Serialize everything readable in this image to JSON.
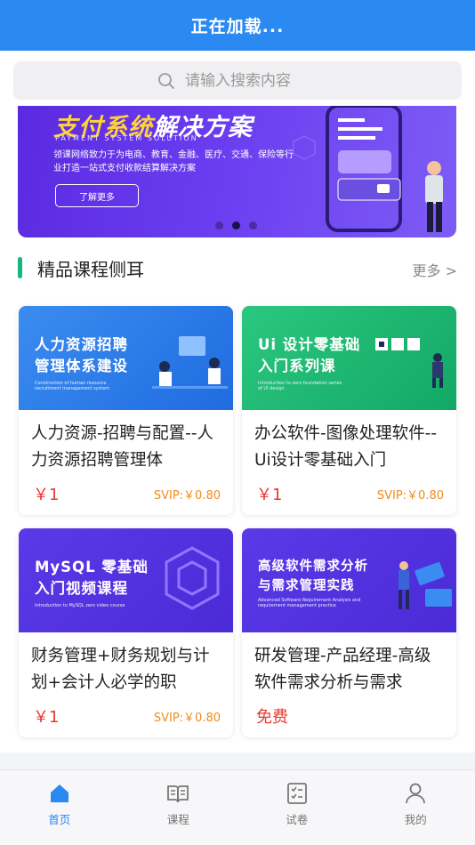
{
  "header": {
    "title": "正在加载..."
  },
  "search": {
    "placeholder": "请输入搜索内容",
    "icon": "search-icon"
  },
  "banner": {
    "title_accent": "支付系统",
    "title_rest": "解决方案",
    "subtitle": "PAYMENT SYSTEM SOLUTION",
    "description": "领课网络致力于为电商、教育、金融、医疗、交通、保险等行业打造一站式支付收款结算解决方案",
    "button_label": "了解更多",
    "active_slide": 2,
    "slide_count": 3
  },
  "section": {
    "title": "精品课程侧耳",
    "more_label": "更多 >"
  },
  "courses": [
    {
      "thumb_title_1": "人力资源招聘",
      "thumb_title_2": "管理体系建设",
      "thumb_sub": "Construction of human resource recruitment management system",
      "title": "人力资源-招聘与配置--人力资源招聘管理体",
      "price": "￥1",
      "svip": "SVIP:￥0.80"
    },
    {
      "thumb_title_1": "Ui 设计零基础",
      "thumb_title_2": "入门系列课",
      "thumb_sub": "Introduction to zero foundation series of UI design",
      "title": "办公软件-图像处理软件--Ui设计零基础入门",
      "price": "￥1",
      "svip": "SVIP:￥0.80"
    },
    {
      "thumb_title_1": "MySQL 零基础",
      "thumb_title_2": "入门视频课程",
      "thumb_sub": "Introduction to MySQL zero video course",
      "title": "财务管理+财务规划与计划+会计人必学的职",
      "price": "￥1",
      "svip": "SVIP:￥0.80"
    },
    {
      "thumb_title_1": "高级软件需求分析",
      "thumb_title_2": "与需求管理实践",
      "thumb_sub": "Advanced Software Requirement Analysis and requirement management practice",
      "title": "研发管理-产品经理-高级软件需求分析与需求",
      "price": "免费",
      "svip": ""
    }
  ],
  "tabbar": {
    "items": [
      {
        "label": "首页",
        "icon": "home-icon",
        "active": true
      },
      {
        "label": "课程",
        "icon": "book-icon",
        "active": false
      },
      {
        "label": "试卷",
        "icon": "exam-icon",
        "active": false
      },
      {
        "label": "我的",
        "icon": "user-icon",
        "active": false
      }
    ]
  },
  "colors": {
    "primary": "#2a8af2",
    "accent_green": "#13b87a",
    "price_red": "#e8392c",
    "svip_orange": "#f08c1d"
  }
}
